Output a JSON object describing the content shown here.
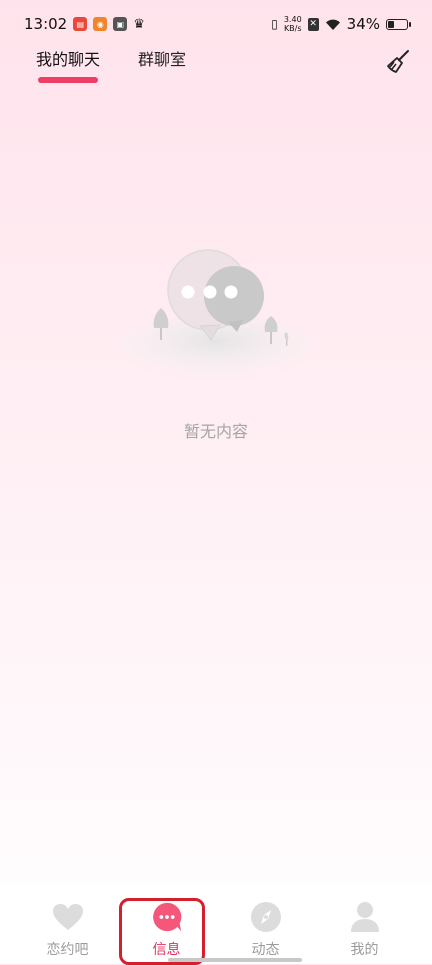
{
  "status_bar": {
    "time": "13:02",
    "net_speed_value": "3.40",
    "net_speed_unit": "KB/s",
    "battery": "34%",
    "battery_level": 0.34
  },
  "tabs": [
    {
      "label": "我的聊天",
      "active": true
    },
    {
      "label": "群聊室",
      "active": false
    }
  ],
  "header": {
    "clean_icon": "broom-icon"
  },
  "empty_state": {
    "text": "暂无内容",
    "icon": "chat-bubbles-illustration"
  },
  "bottom_nav": [
    {
      "label": "恋约吧",
      "icon": "heart-icon",
      "active": false
    },
    {
      "label": "信息",
      "icon": "message-icon",
      "active": true
    },
    {
      "label": "动态",
      "icon": "compass-icon",
      "active": false
    },
    {
      "label": "我的",
      "icon": "person-icon",
      "active": false
    }
  ],
  "colors": {
    "accent": "#ef3e66",
    "active_label": "#e03060",
    "inactive": "#9b9b9b",
    "highlight": "#d4202c"
  }
}
